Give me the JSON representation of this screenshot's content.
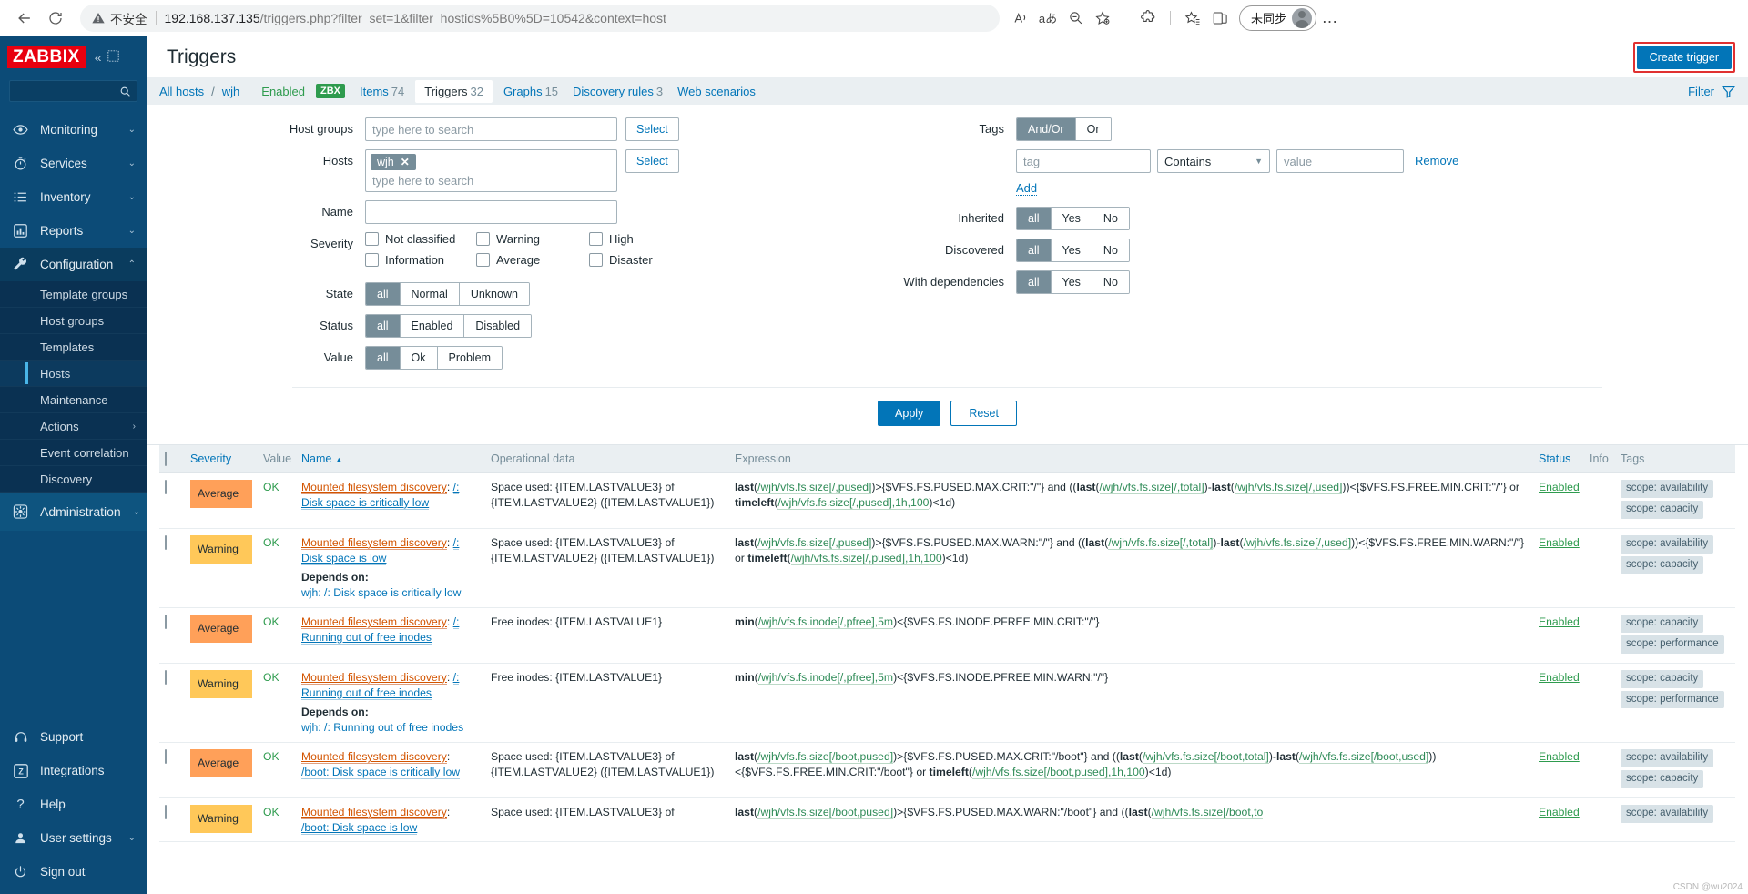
{
  "browser": {
    "security_label": "不安全",
    "url_host": "192.168.137.135",
    "url_path": "/triggers.php?filter_set=1&filter_hostids%5B0%5D=10542&context=host",
    "profile_label": "未同步",
    "icons": {
      "back": "back-arrow-icon",
      "reload": "reload-icon",
      "read_aloud": "read-aloud-icon",
      "translate": "translate-icon",
      "zoom_out": "zoom-out-icon",
      "favorite": "add-favorite-icon",
      "extensions": "extensions-icon",
      "collections": "collections-icon",
      "split_screen": "split-screen-icon",
      "more": "more-options-icon"
    }
  },
  "sidebar": {
    "logo": "ZABBIX",
    "collapse_label": "«",
    "items": [
      {
        "label": "Monitoring",
        "icon": "eye-icon",
        "has_chevron": true
      },
      {
        "label": "Services",
        "icon": "stopwatch-icon",
        "has_chevron": true
      },
      {
        "label": "Inventory",
        "icon": "list-icon",
        "has_chevron": true
      },
      {
        "label": "Reports",
        "icon": "bar-chart-icon",
        "has_chevron": true
      },
      {
        "label": "Configuration",
        "icon": "wrench-icon",
        "has_chevron": true,
        "active": true
      },
      {
        "label": "Administration",
        "icon": "gear-icon",
        "has_chevron": true
      }
    ],
    "submenu": [
      {
        "label": "Template groups"
      },
      {
        "label": "Host groups"
      },
      {
        "label": "Templates"
      },
      {
        "label": "Hosts",
        "selected": true
      },
      {
        "label": "Maintenance"
      },
      {
        "label": "Actions",
        "has_chevron": true
      },
      {
        "label": "Event correlation"
      },
      {
        "label": "Discovery"
      }
    ],
    "bottom_items": [
      {
        "label": "Support",
        "icon": "headset-icon"
      },
      {
        "label": "Integrations",
        "icon": "zabbix-z-icon"
      },
      {
        "label": "Help",
        "icon": "question-icon"
      },
      {
        "label": "User settings",
        "icon": "user-icon",
        "has_chevron": true
      },
      {
        "label": "Sign out",
        "icon": "power-icon"
      }
    ]
  },
  "header": {
    "title": "Triggers",
    "help_icon": "question-mark-icon",
    "create_button": "Create trigger"
  },
  "breadcrumb": {
    "all_hosts": "All hosts",
    "separator": "/",
    "host": "wjh",
    "status": "Enabled",
    "agent_tag": "ZBX",
    "tabs": [
      {
        "label": "Items",
        "count": "74",
        "selected": false
      },
      {
        "label": "Triggers",
        "count": "32",
        "selected": true
      },
      {
        "label": "Graphs",
        "count": "15",
        "selected": false
      },
      {
        "label": "Discovery rules",
        "count": "3",
        "selected": false
      },
      {
        "label": "Web scenarios",
        "count": "",
        "selected": false
      }
    ],
    "filter_label": "Filter",
    "filter_icon": "funnel-icon"
  },
  "filter": {
    "host_groups": {
      "label": "Host groups",
      "placeholder": "type here to search",
      "value": "",
      "select_button": "Select"
    },
    "hosts": {
      "label": "Hosts",
      "chip": "wjh",
      "placeholder": "type here to search",
      "select_button": "Select"
    },
    "name": {
      "label": "Name",
      "value": "",
      "placeholder": ""
    },
    "severity": {
      "label": "Severity",
      "options": [
        {
          "label": "Not classified",
          "checked": false
        },
        {
          "label": "Warning",
          "checked": false
        },
        {
          "label": "High",
          "checked": false
        },
        {
          "label": "Information",
          "checked": false
        },
        {
          "label": "Average",
          "checked": false
        },
        {
          "label": "Disaster",
          "checked": false
        }
      ]
    },
    "state": {
      "label": "State",
      "options": [
        "all",
        "Normal",
        "Unknown"
      ],
      "selected": "all"
    },
    "status": {
      "label": "Status",
      "options": [
        "all",
        "Enabled",
        "Disabled"
      ],
      "selected": "all"
    },
    "value": {
      "label": "Value",
      "options": [
        "all",
        "Ok",
        "Problem"
      ],
      "selected": "all"
    },
    "tags": {
      "label": "Tags",
      "operator_options": [
        "And/Or",
        "Or"
      ],
      "operator_selected": "And/Or",
      "tag_placeholder": "tag",
      "condition": "Contains",
      "value_placeholder": "value",
      "remove_label": "Remove",
      "add_label": "Add"
    },
    "inherited": {
      "label": "Inherited",
      "options": [
        "all",
        "Yes",
        "No"
      ],
      "selected": "all"
    },
    "discovered": {
      "label": "Discovered",
      "options": [
        "all",
        "Yes",
        "No"
      ],
      "selected": "all"
    },
    "dependencies": {
      "label": "With dependencies",
      "options": [
        "all",
        "Yes",
        "No"
      ],
      "selected": "all"
    },
    "apply_button": "Apply",
    "reset_button": "Reset"
  },
  "table": {
    "columns": [
      "Severity",
      "Value",
      "Name",
      "Operational data",
      "Expression",
      "Status",
      "Info",
      "Tags"
    ],
    "sort_column": "Name",
    "sort_dir": "▲",
    "rows": [
      {
        "severity": "Average",
        "severity_class": "sev-average",
        "value": "OK",
        "name_prefix": "Mounted filesystem discovery",
        "name_sep": ": ",
        "name_link": "/",
        "name_rest": ": Disk space is critically low",
        "operational_data": "Space used: {ITEM.LASTVALUE3} of {ITEM.LASTVALUE2} ({ITEM.LASTVALUE1})",
        "expression": "last(/wjh/vfs.fs.size[/,pused])>{$VFS.FS.PUSED.MAX.CRIT:\"/\"} and ((last(/wjh/vfs.fs.size[/,total])-last(/wjh/vfs.fs.size[/,used]))<{$VFS.FS.FREE.MIN.CRIT:\"/\"} or timeleft(/wjh/vfs.fs.size[/,pused],1h,100)<1d)",
        "depends_on": "",
        "status": "Enabled",
        "info": "",
        "tags": [
          "scope: availability",
          "scope: capacity"
        ]
      },
      {
        "severity": "Warning",
        "severity_class": "sev-warning",
        "value": "OK",
        "name_prefix": "Mounted filesystem discovery",
        "name_sep": ": ",
        "name_link": "/",
        "name_rest": ": Disk space is low",
        "operational_data": "Space used: {ITEM.LASTVALUE3} of {ITEM.LASTVALUE2} ({ITEM.LASTVALUE1})",
        "expression": "last(/wjh/vfs.fs.size[/,pused])>{$VFS.FS.PUSED.MAX.WARN:\"/\"} and ((last(/wjh/vfs.fs.size[/,total])-last(/wjh/vfs.fs.size[/,used]))<{$VFS.FS.FREE.MIN.WARN:\"/\"} or timeleft(/wjh/vfs.fs.size[/,pused],1h,100)<1d)",
        "depends_on": "wjh: /: Disk space is critically low",
        "depends_label": "Depends on:",
        "status": "Enabled",
        "info": "",
        "tags": [
          "scope: availability",
          "scope: capacity"
        ]
      },
      {
        "severity": "Average",
        "severity_class": "sev-average",
        "value": "OK",
        "name_prefix": "Mounted filesystem discovery",
        "name_sep": ": ",
        "name_link": "/",
        "name_rest": ": Running out of free inodes",
        "operational_data": "Free inodes: {ITEM.LASTVALUE1}",
        "expression": "min(/wjh/vfs.fs.inode[/,pfree],5m)<{$VFS.FS.INODE.PFREE.MIN.CRIT:\"/\"}",
        "depends_on": "",
        "status": "Enabled",
        "info": "",
        "tags": [
          "scope: capacity",
          "scope: performance"
        ]
      },
      {
        "severity": "Warning",
        "severity_class": "sev-warning",
        "value": "OK",
        "name_prefix": "Mounted filesystem discovery",
        "name_sep": ": ",
        "name_link": "/",
        "name_rest": ": Running out of free inodes",
        "operational_data": "Free inodes: {ITEM.LASTVALUE1}",
        "expression": "min(/wjh/vfs.fs.inode[/,pfree],5m)<{$VFS.FS.INODE.PFREE.MIN.WARN:\"/\"}",
        "depends_on": "wjh: /: Running out of free inodes",
        "depends_label": "Depends on:",
        "status": "Enabled",
        "info": "",
        "tags": [
          "scope: capacity",
          "scope: performance"
        ]
      },
      {
        "severity": "Average",
        "severity_class": "sev-average",
        "value": "OK",
        "name_prefix": "Mounted filesystem discovery",
        "name_sep": ": ",
        "name_link": "/boot",
        "name_rest": ": Disk space is critically low",
        "operational_data": "Space used: {ITEM.LASTVALUE3} of {ITEM.LASTVALUE2} ({ITEM.LASTVALUE1})",
        "expression": "last(/wjh/vfs.fs.size[/boot,pused])>{$VFS.FS.PUSED.MAX.CRIT:\"/boot\"} and ((last(/wjh/vfs.fs.size[/boot,total])-last(/wjh/vfs.fs.size[/boot,used]))<{$VFS.FS.FREE.MIN.CRIT:\"/boot\"} or timeleft(/wjh/vfs.fs.size[/boot,pused],1h,100)<1d)",
        "depends_on": "",
        "status": "Enabled",
        "info": "",
        "tags": [
          "scope: availability",
          "scope: capacity"
        ]
      },
      {
        "severity": "Warning",
        "severity_class": "sev-warning",
        "value": "OK",
        "name_prefix": "Mounted filesystem discovery",
        "name_sep": ": ",
        "name_link": "/boot",
        "name_rest": ": Disk space is low",
        "operational_data": "Space used: {ITEM.LASTVALUE3} of",
        "expression": "last(/wjh/vfs.fs.size[/boot,pused])>{$VFS.FS.PUSED.MAX.WARN:\"/boot\"} and ((last(/wjh/vfs.fs.size[/boot,to",
        "depends_on": "",
        "status": "Enabled",
        "info": "",
        "tags": [
          "scope: availability"
        ]
      }
    ]
  },
  "watermark": "CSDN @wu2024"
}
